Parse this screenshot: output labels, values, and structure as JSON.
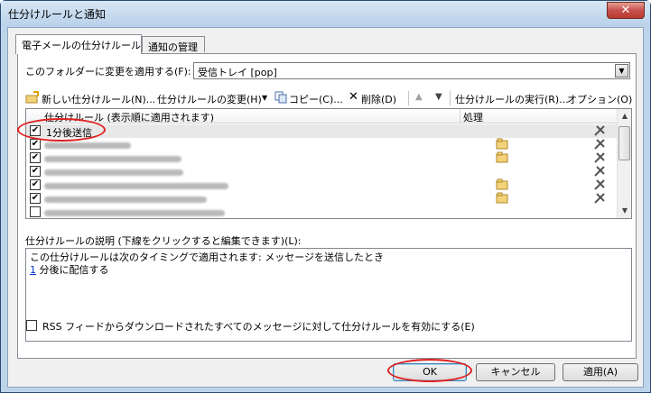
{
  "window": {
    "title": "仕分けルールと通知",
    "close": "✕"
  },
  "tabs": [
    {
      "label": "電子メールの仕分けルール"
    },
    {
      "label": "通知の管理"
    }
  ],
  "folder": {
    "label": "このフォルダーに変更を適用する(F):",
    "value": "受信トレイ [pop]"
  },
  "toolbar": {
    "new_rule": "新しい仕分けルール(N)...",
    "change_rule": "仕分けルールの変更(H)",
    "copy": "コピー(C)...",
    "delete": "削除(D)",
    "run_rules": "仕分けルールの実行(R)...",
    "options": "オプション(O)"
  },
  "list": {
    "col_rule": "仕分けルール (表示順に適用されます)",
    "col_action": "処理",
    "rows": [
      {
        "name": "1分後送信",
        "checked": true
      }
    ]
  },
  "description": {
    "label": "仕分けルールの説明 (下線をクリックすると編集できます)(L):",
    "line1": "この仕分けルールは次のタイミングで適用されます: メッセージを送信したとき",
    "line2_link": "1",
    "line2_rest": " 分後に配信する"
  },
  "rss": {
    "label": "RSS フィードからダウンロードされたすべてのメッセージに対して仕分けルールを有効にする(E)"
  },
  "buttons": {
    "ok": "OK",
    "cancel": "キャンセル",
    "apply": "適用(A)"
  },
  "icons": {
    "new_rule": "new-rule-icon",
    "copy": "copy-icon",
    "delete": "delete-icon",
    "move_up": "arrow-up-icon",
    "move_down": "arrow-down-icon",
    "action": "move-to-folder-icon",
    "tools": "tools-icon"
  },
  "colors": {
    "highlight": "#e02020",
    "link": "#0033cc"
  }
}
